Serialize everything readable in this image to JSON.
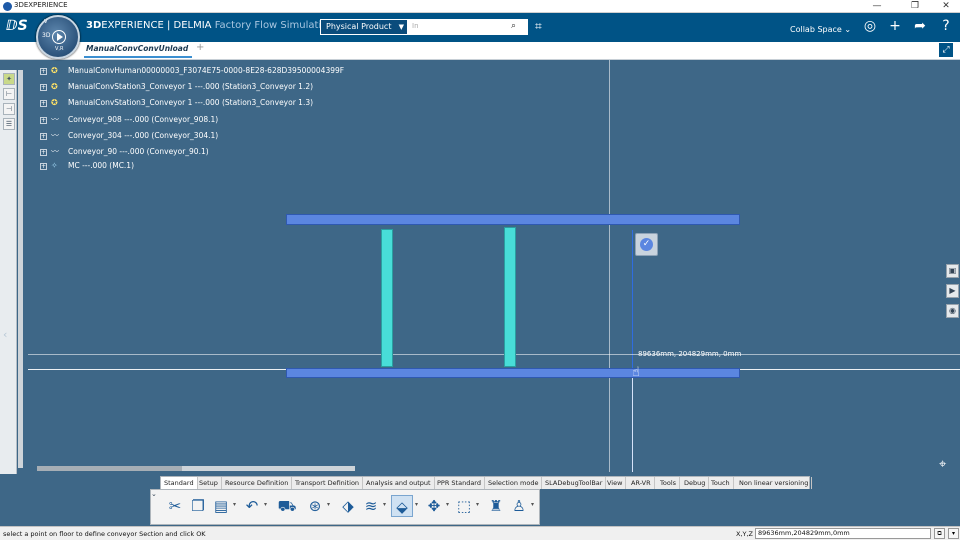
{
  "os": {
    "title": "3DEXPERIENCE",
    "minimize": "—",
    "maximize": "❐",
    "close": "✕"
  },
  "header": {
    "brand_prefix": "3D",
    "brand_main": "EXPERIENCE | DELMIA",
    "app_name": "Factory Flow Simulation",
    "compass_3d": "3D",
    "compass_v": "V",
    "compass_ver": "V,R",
    "search_scope": "Physical Product",
    "search_placeholder": "In",
    "collab_space": "Collab Space"
  },
  "tab": {
    "label": "ManualConvConvUnload",
    "add": "+"
  },
  "tree": [
    {
      "label": "ManualConvHuman00000003_F3074E75-0000-8E28-628D39500004399F"
    },
    {
      "label": "ManualConvStation3_Conveyor 1 ---.000 (Station3_Conveyor 1.2)"
    },
    {
      "label": "ManualConvStation3_Conveyor 1 ---.000 (Station3_Conveyor 1.3)"
    },
    {
      "label": "Conveyor_908 ---.000 (Conveyor_908.1)"
    },
    {
      "label": "Conveyor_304 ---.000 (Conveyor_304.1)"
    },
    {
      "label": "Conveyor_90 ---.000 (Conveyor_90.1)"
    },
    {
      "label": "MC ---.000 (MC.1)"
    }
  ],
  "viewport": {
    "coord_label": "89636mm, 204829mm, 0mm",
    "ok_icon": "✓"
  },
  "actionbar": {
    "tabs": [
      "Standard",
      "Setup",
      "Resource Definition",
      "Transport Definition",
      "Analysis and output",
      "PPR Standard",
      "Selection mode",
      "SLADebugToolBar",
      "View",
      "AR-VR",
      "Tools",
      "Debug",
      "Touch",
      "Non linear versioning"
    ],
    "active_tab": "Standard",
    "tools": [
      "cut-icon",
      "copy-icon",
      "paste-icon",
      "undo-icon",
      "conveyor-icon",
      "flow-icon",
      "resource-icon",
      "path-icon",
      "floor-icon",
      "move-icon",
      "bounding-box-icon",
      "robot-icon",
      "worker-icon"
    ]
  },
  "status": {
    "message": "select a point on floor to define conveyor Section and click OK",
    "xyz_label": "X,Y,Z",
    "xyz_value": "89636mm,204829mm,0mm"
  }
}
